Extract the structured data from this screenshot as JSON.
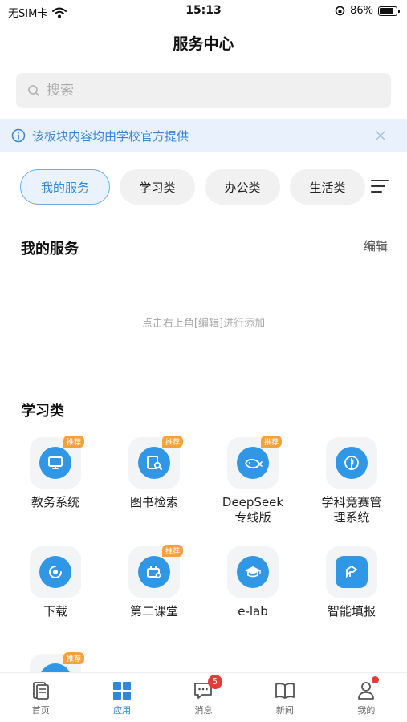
{
  "status_bar": {
    "carrier": "无SIM卡",
    "time": "15:13",
    "battery_percent": "86%",
    "battery_level": 0.86
  },
  "header": {
    "title": "服务中心"
  },
  "search": {
    "placeholder": "搜索"
  },
  "notice": {
    "text": "该板块内容均由学校官方提供"
  },
  "tabs": [
    {
      "label": "我的服务",
      "active": true
    },
    {
      "label": "学习类",
      "active": false
    },
    {
      "label": "办公类",
      "active": false
    },
    {
      "label": "生活类",
      "active": false
    }
  ],
  "my_services": {
    "title": "我的服务",
    "edit_label": "编辑",
    "empty_hint": "点击右上角[编辑]进行添加"
  },
  "study": {
    "title": "学习类",
    "badge_label": "推荐",
    "apps": [
      {
        "label": "教务系统",
        "icon": "monitor-icon",
        "recommended": true
      },
      {
        "label": "图书检索",
        "icon": "book-search-icon",
        "recommended": true
      },
      {
        "label": "DeepSeek专线版",
        "label_line1": "DeepSeek",
        "label_line2": "专线版",
        "icon": "whale-icon",
        "recommended": true
      },
      {
        "label": "学科竞赛管理系统",
        "label_line1": "学科竞赛管",
        "label_line2": "理系统",
        "icon": "trophy-icon",
        "recommended": false
      },
      {
        "label": "下载",
        "icon": "download-icon",
        "recommended": false
      },
      {
        "label": "第二课堂",
        "icon": "classroom-icon",
        "recommended": true
      },
      {
        "label": "e-lab",
        "icon": "graduation-cap-icon",
        "recommended": false
      },
      {
        "label": "智能填报",
        "icon": "form-fill-icon",
        "recommended": false
      },
      {
        "label": "",
        "icon": "app-icon",
        "recommended": true
      }
    ]
  },
  "bottom_nav": [
    {
      "label": "首页",
      "icon": "home-doc-icon",
      "active": false
    },
    {
      "label": "应用",
      "icon": "apps-grid-icon",
      "active": true
    },
    {
      "label": "消息",
      "icon": "message-icon",
      "active": false,
      "badge": "5"
    },
    {
      "label": "新闻",
      "icon": "news-book-icon",
      "active": false
    },
    {
      "label": "我的",
      "icon": "profile-icon",
      "active": false,
      "dot": true
    }
  ],
  "colors": {
    "accent": "#2f88d8",
    "icon_blue": "#2f97e6",
    "badge_orange": "#f7a13a",
    "alert_red": "#e93a3a",
    "notice_bg": "#e9f2fc"
  }
}
